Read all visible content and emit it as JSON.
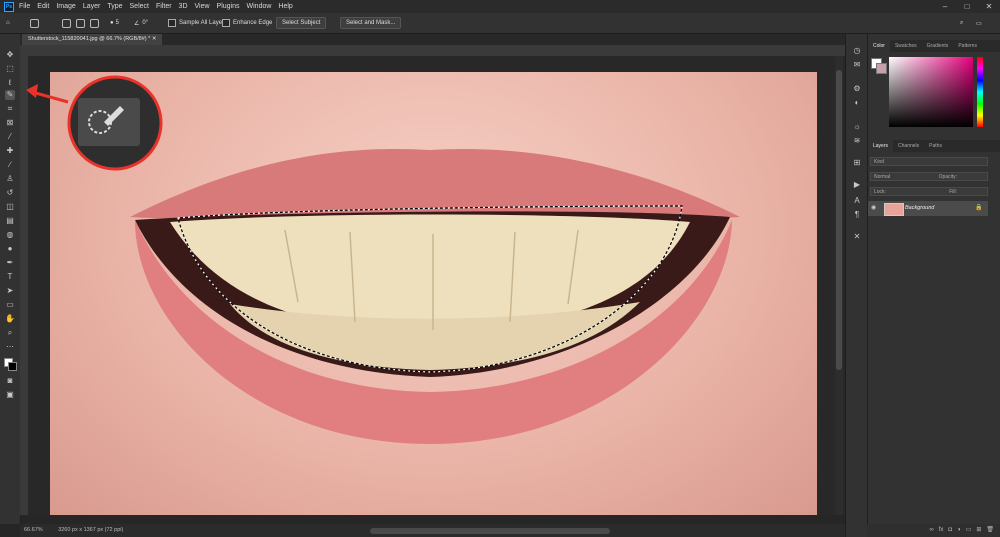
{
  "menu": {
    "logo": "Ps",
    "items": [
      "File",
      "Edit",
      "Image",
      "Layer",
      "Type",
      "Select",
      "Filter",
      "3D",
      "View",
      "Plugins",
      "Window",
      "Help"
    ]
  },
  "window_controls": {
    "minimize": "–",
    "maximize": "□",
    "close": "✕"
  },
  "options": {
    "brush_size": "5",
    "angle": "0°",
    "sample_all_layers": "Sample All Layers",
    "enhance_edge": "Enhance Edge",
    "select_subject": "Select Subject",
    "select_and_mask": "Select and Mask..."
  },
  "document": {
    "tab_title": "Shutterstock_115820041.jpg @ 66.7% (RGB/8#) *",
    "zoom": "66.67%",
    "dimensions": "3260 px x 1367 px (72 ppi)"
  },
  "panels": {
    "top_tabs": [
      "Color",
      "Swatches",
      "Gradients",
      "Patterns"
    ],
    "layer_tabs": [
      "Layers",
      "Channels",
      "Paths"
    ],
    "kind_label": "Kind",
    "blend_mode": "Normal",
    "opacity_label": "Opacity:",
    "lock_label": "Lock:",
    "fill_label": "Fill:",
    "layer_name": "Background"
  },
  "colors": {
    "accent_red": "#e8322a",
    "foreground": "#ffffff",
    "background": "#c8a0a8"
  },
  "icons": {
    "selected_tool": "quick-selection-icon"
  }
}
